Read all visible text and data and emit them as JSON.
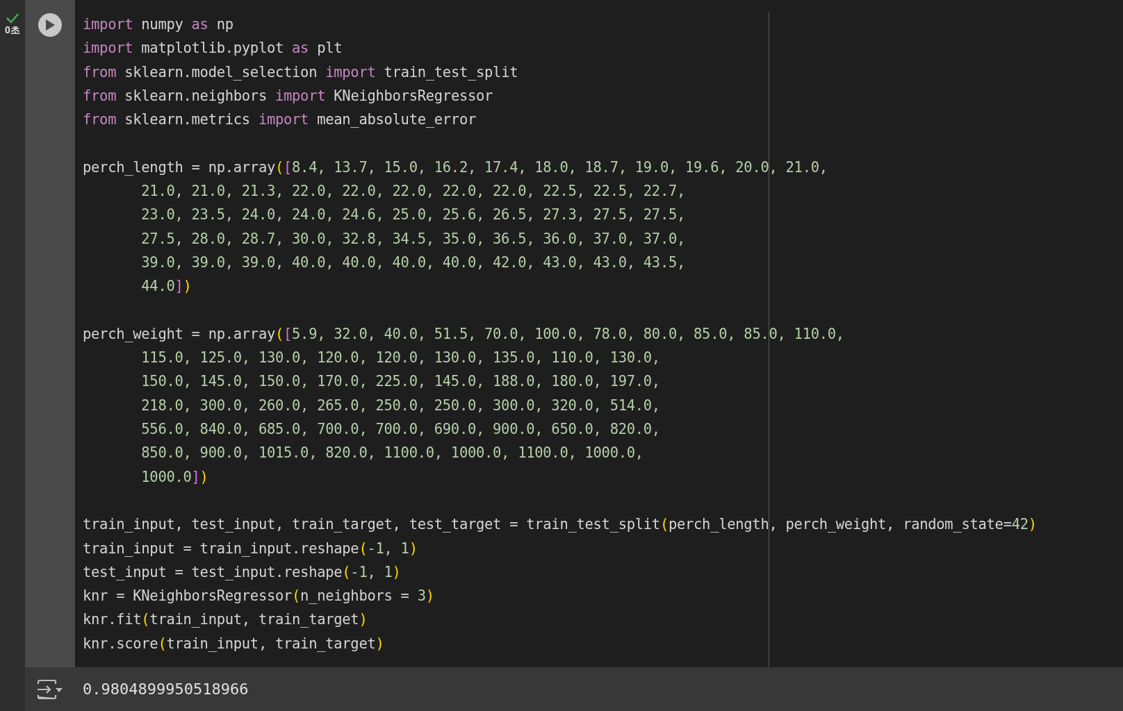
{
  "cell": {
    "status": {
      "done": true,
      "duration": "0초"
    },
    "code_blocks": [
      [
        [
          {
            "kind": "kw",
            "text": "import"
          },
          {
            "kind": "plain",
            "text": " numpy "
          },
          {
            "kind": "kw",
            "text": "as"
          },
          {
            "kind": "plain",
            "text": " np"
          }
        ],
        [
          {
            "kind": "kw",
            "text": "import"
          },
          {
            "kind": "plain",
            "text": " matplotlib.pyplot "
          },
          {
            "kind": "kw",
            "text": "as"
          },
          {
            "kind": "plain",
            "text": " plt"
          }
        ],
        [
          {
            "kind": "kw",
            "text": "from"
          },
          {
            "kind": "plain",
            "text": " sklearn.model_selection "
          },
          {
            "kind": "kw",
            "text": "import"
          },
          {
            "kind": "plain",
            "text": " train_test_split"
          }
        ],
        [
          {
            "kind": "kw",
            "text": "from"
          },
          {
            "kind": "plain",
            "text": " sklearn.neighbors "
          },
          {
            "kind": "kw",
            "text": "import"
          },
          {
            "kind": "plain",
            "text": " KNeighborsRegressor"
          }
        ],
        [
          {
            "kind": "kw",
            "text": "from"
          },
          {
            "kind": "plain",
            "text": " sklearn.metrics "
          },
          {
            "kind": "kw",
            "text": "import"
          },
          {
            "kind": "plain",
            "text": " mean_absolute_error"
          }
        ]
      ],
      [
        [
          {
            "kind": "plain",
            "text": "perch_length = np.array"
          },
          {
            "kind": "paren",
            "text": "("
          },
          {
            "kind": "bracket",
            "text": "["
          },
          {
            "kind": "num",
            "text": "8.4, 13.7, 15.0, 16.2, 17.4, 18.0, 18.7, 19.0, 19.6, 20.0, 21.0,"
          }
        ],
        [
          {
            "kind": "num",
            "text": "       21.0, 21.0, 21.3, 22.0, 22.0, 22.0, 22.0, 22.0, 22.5, 22.5, 22.7,"
          }
        ],
        [
          {
            "kind": "num",
            "text": "       23.0, 23.5, 24.0, 24.0, 24.6, 25.0, 25.6, 26.5, 27.3, 27.5, 27.5,"
          }
        ],
        [
          {
            "kind": "num",
            "text": "       27.5, 28.0, 28.7, 30.0, 32.8, 34.5, 35.0, 36.5, 36.0, 37.0, 37.0,"
          }
        ],
        [
          {
            "kind": "num",
            "text": "       39.0, 39.0, 39.0, 40.0, 40.0, 40.0, 40.0, 42.0, 43.0, 43.0, 43.5,"
          }
        ],
        [
          {
            "kind": "num",
            "text": "       44.0"
          },
          {
            "kind": "bracket",
            "text": "]"
          },
          {
            "kind": "paren",
            "text": ")"
          }
        ]
      ],
      [
        [
          {
            "kind": "plain",
            "text": "perch_weight = np.array"
          },
          {
            "kind": "paren",
            "text": "("
          },
          {
            "kind": "bracket",
            "text": "["
          },
          {
            "kind": "num",
            "text": "5.9, 32.0, 40.0, 51.5, 70.0, 100.0, 78.0, 80.0, 85.0, 85.0, 110.0,"
          }
        ],
        [
          {
            "kind": "num",
            "text": "       115.0, 125.0, 130.0, 120.0, 120.0, 130.0, 135.0, 110.0, 130.0,"
          }
        ],
        [
          {
            "kind": "num",
            "text": "       150.0, 145.0, 150.0, 170.0, 225.0, 145.0, 188.0, 180.0, 197.0,"
          }
        ],
        [
          {
            "kind": "num",
            "text": "       218.0, 300.0, 260.0, 265.0, 250.0, 250.0, 300.0, 320.0, 514.0,"
          }
        ],
        [
          {
            "kind": "num",
            "text": "       556.0, 840.0, 685.0, 700.0, 700.0, 690.0, 900.0, 650.0, 820.0,"
          }
        ],
        [
          {
            "kind": "num",
            "text": "       850.0, 900.0, 1015.0, 820.0, 1100.0, 1000.0, 1100.0, 1000.0,"
          }
        ],
        [
          {
            "kind": "num",
            "text": "       1000.0"
          },
          {
            "kind": "bracket",
            "text": "]"
          },
          {
            "kind": "paren",
            "text": ")"
          }
        ]
      ],
      [
        [
          {
            "kind": "plain",
            "text": "train_input, test_input, train_target, test_target = train_test_split"
          },
          {
            "kind": "paren",
            "text": "("
          },
          {
            "kind": "plain",
            "text": "perch_length, perch_weight, random_state="
          },
          {
            "kind": "num",
            "text": "42"
          },
          {
            "kind": "paren",
            "text": ")"
          }
        ],
        [
          {
            "kind": "plain",
            "text": "train_input = train_input.reshape"
          },
          {
            "kind": "paren",
            "text": "("
          },
          {
            "kind": "num",
            "text": "-1, 1"
          },
          {
            "kind": "paren",
            "text": ")"
          }
        ],
        [
          {
            "kind": "plain",
            "text": "test_input = test_input.reshape"
          },
          {
            "kind": "paren",
            "text": "("
          },
          {
            "kind": "num",
            "text": "-1, 1"
          },
          {
            "kind": "paren",
            "text": ")"
          }
        ],
        [
          {
            "kind": "plain",
            "text": "knr = KNeighborsRegressor"
          },
          {
            "kind": "paren",
            "text": "("
          },
          {
            "kind": "plain",
            "text": "n_neighbors = "
          },
          {
            "kind": "num",
            "text": "3"
          },
          {
            "kind": "paren",
            "text": ")"
          }
        ],
        [
          {
            "kind": "plain",
            "text": "knr.fit"
          },
          {
            "kind": "paren",
            "text": "("
          },
          {
            "kind": "plain",
            "text": "train_input, train_target"
          },
          {
            "kind": "paren",
            "text": ")"
          }
        ],
        [
          {
            "kind": "plain",
            "text": "knr.score"
          },
          {
            "kind": "paren",
            "text": "("
          },
          {
            "kind": "plain",
            "text": "train_input, train_target"
          },
          {
            "kind": "paren",
            "text": ")"
          }
        ]
      ]
    ],
    "output": "0.9804899950518966"
  }
}
